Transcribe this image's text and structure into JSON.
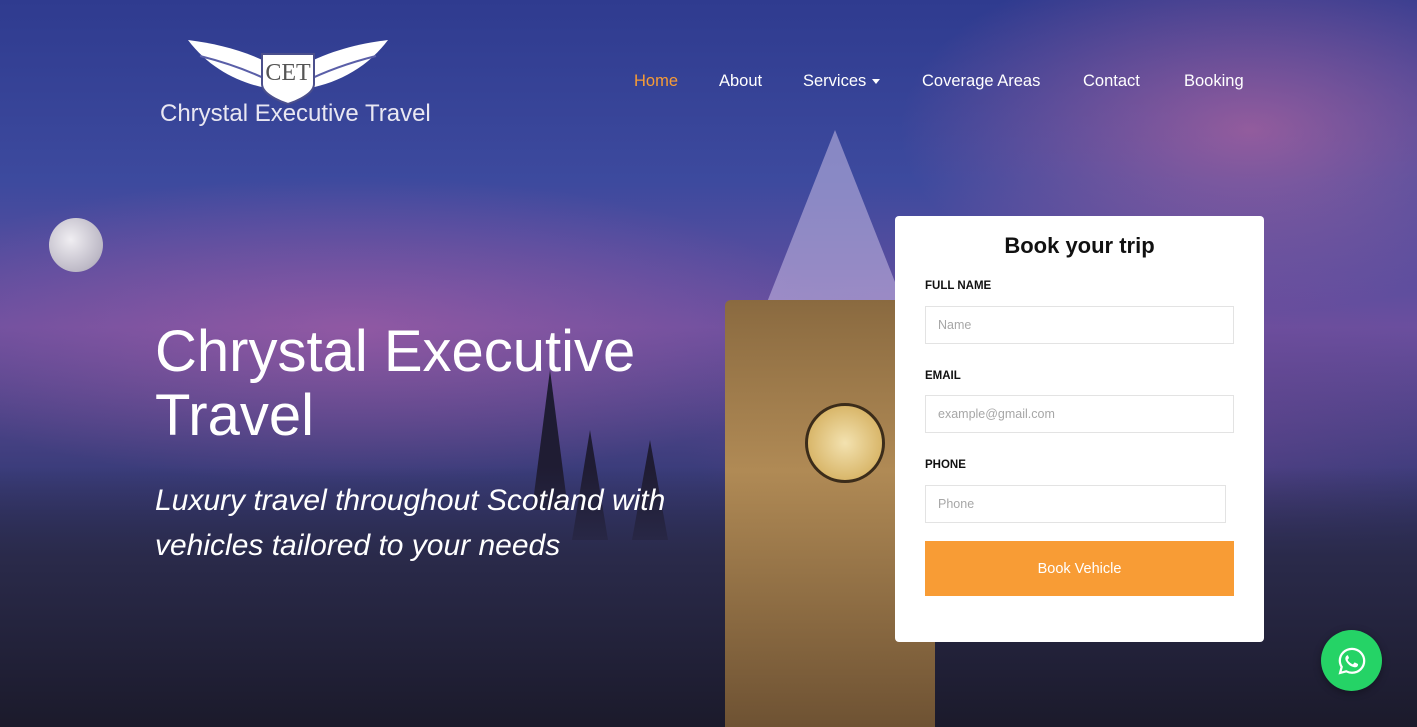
{
  "brand": {
    "logo_text": "Chrystal Executive Travel",
    "emblem_text": "CET"
  },
  "nav": {
    "items": [
      {
        "label": "Home",
        "active": true
      },
      {
        "label": "About"
      },
      {
        "label": "Services",
        "has_dropdown": true
      },
      {
        "label": "Coverage Areas"
      },
      {
        "label": "Contact"
      },
      {
        "label": "Booking"
      }
    ]
  },
  "hero": {
    "title": "Chrystal Executive Travel",
    "subtitle": "Luxury travel throughout Scotland with vehicles tailored to your needs"
  },
  "booking_form": {
    "title": "Book your trip",
    "full_name_label": "FULL NAME",
    "full_name_placeholder": "Name",
    "email_label": "EMAIL",
    "email_placeholder": "example@gmail.com",
    "phone_label": "PHONE",
    "phone_placeholder": "Phone",
    "submit_label": "Book Vehicle"
  },
  "colors": {
    "accent": "#f89c35",
    "whatsapp": "#25d366",
    "nav_text": "#ffffff"
  },
  "icons": {
    "whatsapp": "whatsapp-icon",
    "services_dropdown": "chevron-down-icon"
  }
}
